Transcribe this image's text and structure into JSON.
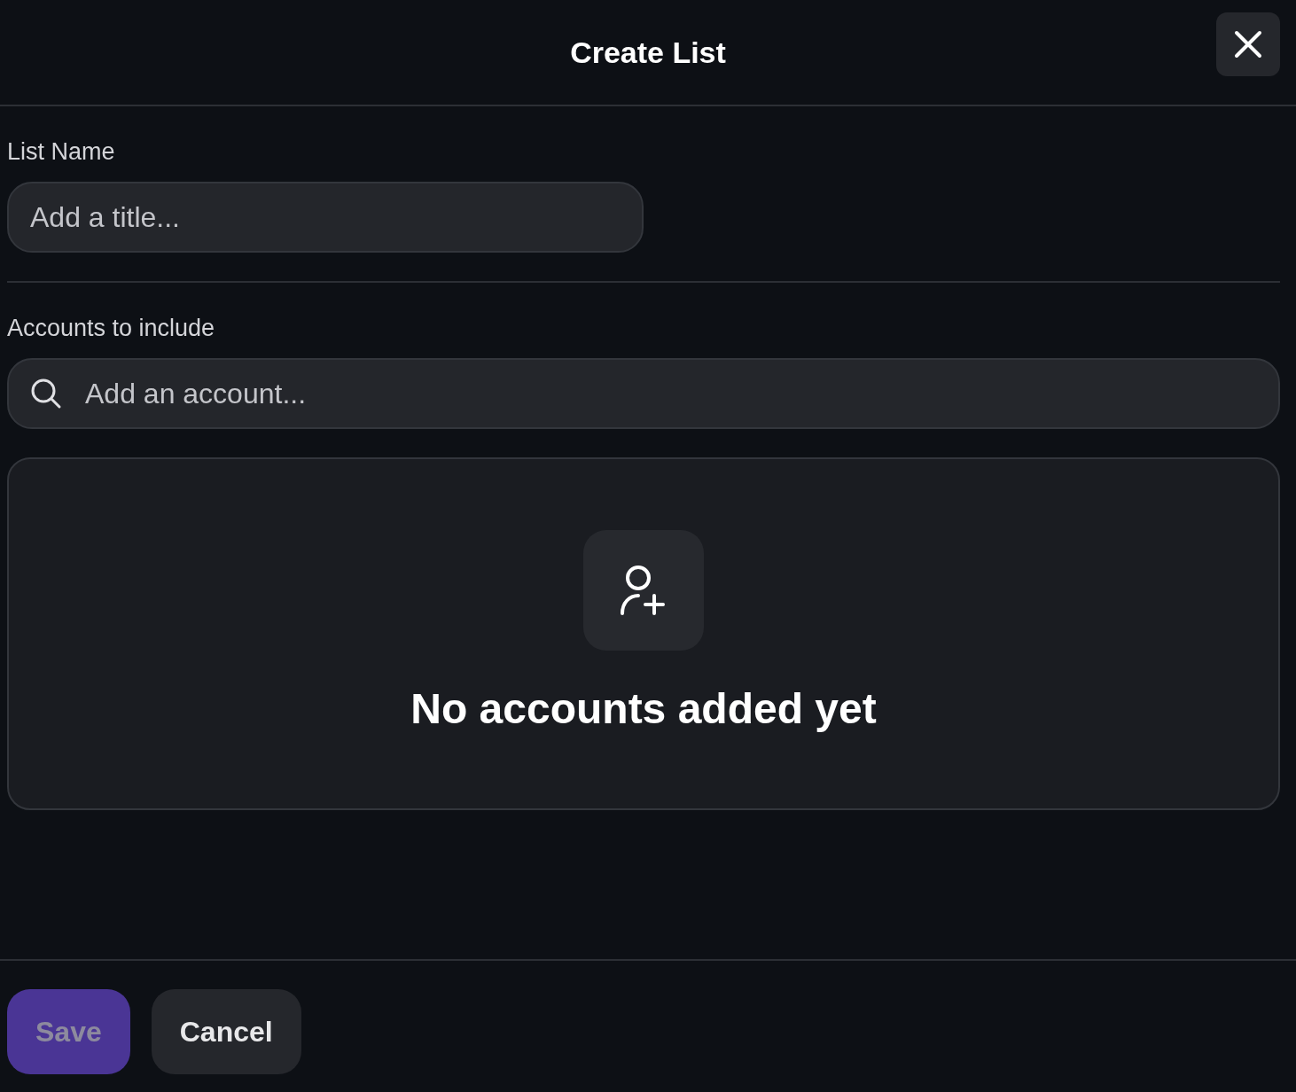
{
  "dialog": {
    "title": "Create List"
  },
  "list_name": {
    "label": "List Name",
    "placeholder": "Add a title..."
  },
  "accounts": {
    "label": "Accounts to include",
    "placeholder": "Add an account...",
    "empty_message": "No accounts added yet"
  },
  "buttons": [
    {
      "label": "Save",
      "kind": "primary",
      "disabled": true
    },
    {
      "label": "Cancel",
      "kind": "secondary",
      "disabled": false
    }
  ]
}
